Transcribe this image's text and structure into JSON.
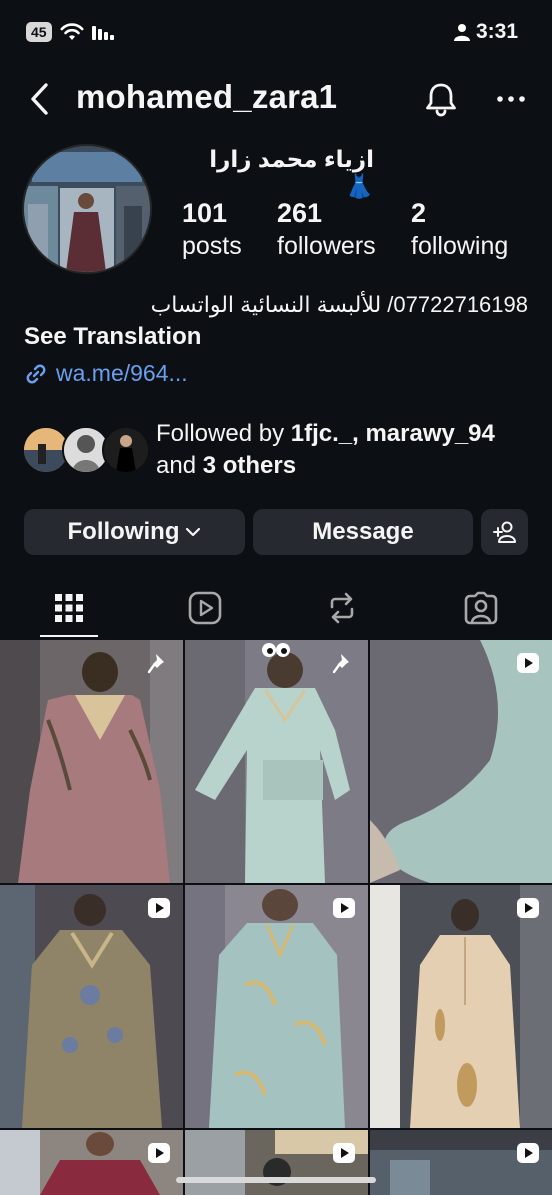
{
  "status_bar": {
    "battery": "45",
    "time": "3:31"
  },
  "nav": {
    "username": "mohamed_zara1"
  },
  "profile": {
    "display_name": "ازياء محمد زارا 👗",
    "stats": [
      {
        "value": "101",
        "label": "posts"
      },
      {
        "value": "261",
        "label": "followers"
      },
      {
        "value": "2",
        "label": "following"
      }
    ],
    "bio": "07722716198/ للألبسة النسائية الواتساب",
    "see_translation": "See Translation",
    "link": "wa.me/964...",
    "followed_by_prefix": "Followed by ",
    "followed_by_names": "1fjc._, marawy_94",
    "followed_by_and": " and ",
    "followed_by_others": "3 others"
  },
  "actions": {
    "following": "Following",
    "message": "Message"
  },
  "tabs": [
    "grid",
    "reels",
    "reposts",
    "tagged"
  ],
  "grid": {
    "badges": [
      "pin",
      "pin",
      "reel",
      "reel",
      "reel",
      "reel",
      "reel",
      "reel",
      "reel"
    ]
  },
  "colors": {
    "background": "#0c1014",
    "button": "#262a30",
    "link": "#6a9ff0"
  }
}
